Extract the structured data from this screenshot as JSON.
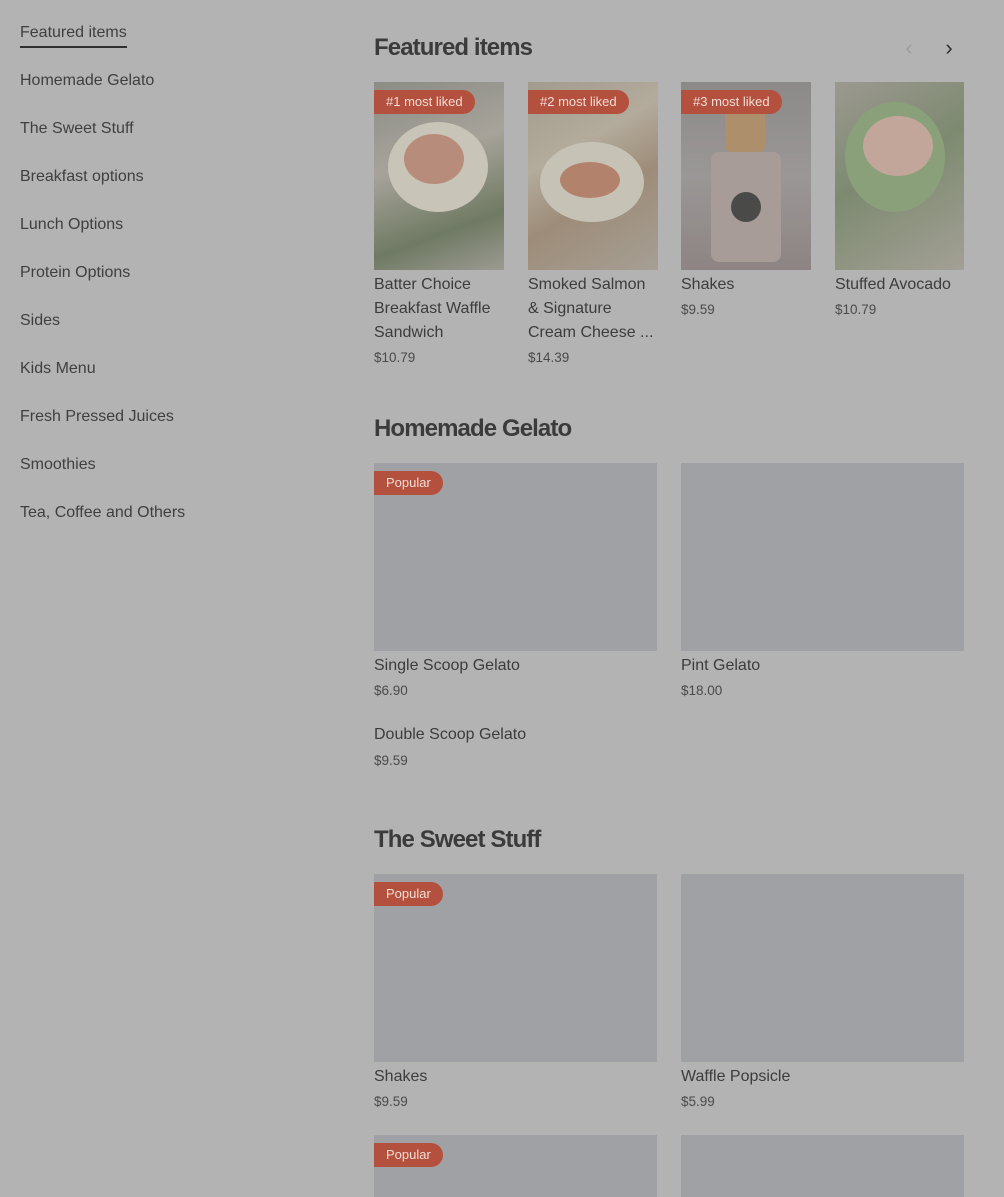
{
  "sidebar": {
    "items": [
      {
        "label": "Featured items",
        "active": true
      },
      {
        "label": "Homemade Gelato"
      },
      {
        "label": "The Sweet Stuff"
      },
      {
        "label": "Breakfast options"
      },
      {
        "label": "Lunch Options"
      },
      {
        "label": "Protein Options"
      },
      {
        "label": "Sides"
      },
      {
        "label": "Kids Menu"
      },
      {
        "label": "Fresh Pressed Juices"
      },
      {
        "label": "Smoothies"
      },
      {
        "label": "Tea, Coffee and Others"
      }
    ]
  },
  "featured": {
    "title": "Featured items",
    "prev_icon": "chevron-left-icon",
    "next_icon": "chevron-right-icon",
    "items": [
      {
        "badge": "#1 most liked",
        "name": "Batter Choice Breakfast  Waffle Sandwich",
        "price": "$10.79"
      },
      {
        "badge": "#2 most liked",
        "name": "Smoked Salmon & Signature Cream Cheese ...",
        "price": "$14.39"
      },
      {
        "badge": "#3 most liked",
        "name": "Shakes",
        "price": "$9.59"
      },
      {
        "name": "Stuffed Avocado",
        "price": "$10.79"
      }
    ]
  },
  "gelato": {
    "title": "Homemade Gelato",
    "items": [
      {
        "badge": "Popular",
        "name": "Single Scoop Gelato",
        "price": "$6.90"
      },
      {
        "name": "Pint Gelato",
        "price": "$18.00"
      },
      {
        "name": "Double Scoop Gelato",
        "price": "$9.59"
      }
    ]
  },
  "sweet": {
    "title": "The Sweet Stuff",
    "items": [
      {
        "badge": "Popular",
        "name": "Shakes",
        "price": "$9.59"
      },
      {
        "name": "Waffle Popsicle",
        "price": "$5.99"
      },
      {
        "badge": "Popular"
      }
    ]
  }
}
